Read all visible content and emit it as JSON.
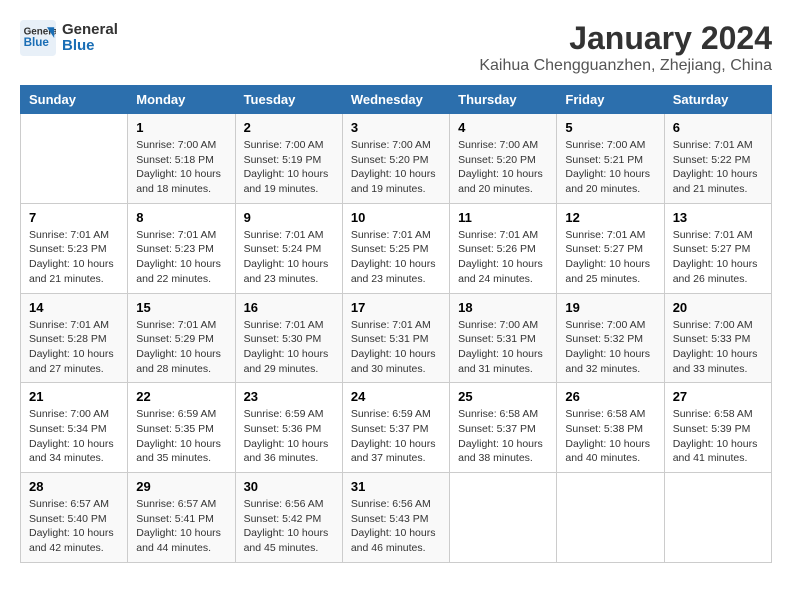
{
  "logo": {
    "text_general": "General",
    "text_blue": "Blue"
  },
  "title": "January 2024",
  "subtitle": "Kaihua Chengguanzhen, Zhejiang, China",
  "days_header": [
    "Sunday",
    "Monday",
    "Tuesday",
    "Wednesday",
    "Thursday",
    "Friday",
    "Saturday"
  ],
  "weeks": [
    [
      {
        "num": "",
        "sunrise": "",
        "sunset": "",
        "daylight": ""
      },
      {
        "num": "1",
        "sunrise": "Sunrise: 7:00 AM",
        "sunset": "Sunset: 5:18 PM",
        "daylight": "Daylight: 10 hours and 18 minutes."
      },
      {
        "num": "2",
        "sunrise": "Sunrise: 7:00 AM",
        "sunset": "Sunset: 5:19 PM",
        "daylight": "Daylight: 10 hours and 19 minutes."
      },
      {
        "num": "3",
        "sunrise": "Sunrise: 7:00 AM",
        "sunset": "Sunset: 5:20 PM",
        "daylight": "Daylight: 10 hours and 19 minutes."
      },
      {
        "num": "4",
        "sunrise": "Sunrise: 7:00 AM",
        "sunset": "Sunset: 5:20 PM",
        "daylight": "Daylight: 10 hours and 20 minutes."
      },
      {
        "num": "5",
        "sunrise": "Sunrise: 7:00 AM",
        "sunset": "Sunset: 5:21 PM",
        "daylight": "Daylight: 10 hours and 20 minutes."
      },
      {
        "num": "6",
        "sunrise": "Sunrise: 7:01 AM",
        "sunset": "Sunset: 5:22 PM",
        "daylight": "Daylight: 10 hours and 21 minutes."
      }
    ],
    [
      {
        "num": "7",
        "sunrise": "Sunrise: 7:01 AM",
        "sunset": "Sunset: 5:23 PM",
        "daylight": "Daylight: 10 hours and 21 minutes."
      },
      {
        "num": "8",
        "sunrise": "Sunrise: 7:01 AM",
        "sunset": "Sunset: 5:23 PM",
        "daylight": "Daylight: 10 hours and 22 minutes."
      },
      {
        "num": "9",
        "sunrise": "Sunrise: 7:01 AM",
        "sunset": "Sunset: 5:24 PM",
        "daylight": "Daylight: 10 hours and 23 minutes."
      },
      {
        "num": "10",
        "sunrise": "Sunrise: 7:01 AM",
        "sunset": "Sunset: 5:25 PM",
        "daylight": "Daylight: 10 hours and 23 minutes."
      },
      {
        "num": "11",
        "sunrise": "Sunrise: 7:01 AM",
        "sunset": "Sunset: 5:26 PM",
        "daylight": "Daylight: 10 hours and 24 minutes."
      },
      {
        "num": "12",
        "sunrise": "Sunrise: 7:01 AM",
        "sunset": "Sunset: 5:27 PM",
        "daylight": "Daylight: 10 hours and 25 minutes."
      },
      {
        "num": "13",
        "sunrise": "Sunrise: 7:01 AM",
        "sunset": "Sunset: 5:27 PM",
        "daylight": "Daylight: 10 hours and 26 minutes."
      }
    ],
    [
      {
        "num": "14",
        "sunrise": "Sunrise: 7:01 AM",
        "sunset": "Sunset: 5:28 PM",
        "daylight": "Daylight: 10 hours and 27 minutes."
      },
      {
        "num": "15",
        "sunrise": "Sunrise: 7:01 AM",
        "sunset": "Sunset: 5:29 PM",
        "daylight": "Daylight: 10 hours and 28 minutes."
      },
      {
        "num": "16",
        "sunrise": "Sunrise: 7:01 AM",
        "sunset": "Sunset: 5:30 PM",
        "daylight": "Daylight: 10 hours and 29 minutes."
      },
      {
        "num": "17",
        "sunrise": "Sunrise: 7:01 AM",
        "sunset": "Sunset: 5:31 PM",
        "daylight": "Daylight: 10 hours and 30 minutes."
      },
      {
        "num": "18",
        "sunrise": "Sunrise: 7:00 AM",
        "sunset": "Sunset: 5:31 PM",
        "daylight": "Daylight: 10 hours and 31 minutes."
      },
      {
        "num": "19",
        "sunrise": "Sunrise: 7:00 AM",
        "sunset": "Sunset: 5:32 PM",
        "daylight": "Daylight: 10 hours and 32 minutes."
      },
      {
        "num": "20",
        "sunrise": "Sunrise: 7:00 AM",
        "sunset": "Sunset: 5:33 PM",
        "daylight": "Daylight: 10 hours and 33 minutes."
      }
    ],
    [
      {
        "num": "21",
        "sunrise": "Sunrise: 7:00 AM",
        "sunset": "Sunset: 5:34 PM",
        "daylight": "Daylight: 10 hours and 34 minutes."
      },
      {
        "num": "22",
        "sunrise": "Sunrise: 6:59 AM",
        "sunset": "Sunset: 5:35 PM",
        "daylight": "Daylight: 10 hours and 35 minutes."
      },
      {
        "num": "23",
        "sunrise": "Sunrise: 6:59 AM",
        "sunset": "Sunset: 5:36 PM",
        "daylight": "Daylight: 10 hours and 36 minutes."
      },
      {
        "num": "24",
        "sunrise": "Sunrise: 6:59 AM",
        "sunset": "Sunset: 5:37 PM",
        "daylight": "Daylight: 10 hours and 37 minutes."
      },
      {
        "num": "25",
        "sunrise": "Sunrise: 6:58 AM",
        "sunset": "Sunset: 5:37 PM",
        "daylight": "Daylight: 10 hours and 38 minutes."
      },
      {
        "num": "26",
        "sunrise": "Sunrise: 6:58 AM",
        "sunset": "Sunset: 5:38 PM",
        "daylight": "Daylight: 10 hours and 40 minutes."
      },
      {
        "num": "27",
        "sunrise": "Sunrise: 6:58 AM",
        "sunset": "Sunset: 5:39 PM",
        "daylight": "Daylight: 10 hours and 41 minutes."
      }
    ],
    [
      {
        "num": "28",
        "sunrise": "Sunrise: 6:57 AM",
        "sunset": "Sunset: 5:40 PM",
        "daylight": "Daylight: 10 hours and 42 minutes."
      },
      {
        "num": "29",
        "sunrise": "Sunrise: 6:57 AM",
        "sunset": "Sunset: 5:41 PM",
        "daylight": "Daylight: 10 hours and 44 minutes."
      },
      {
        "num": "30",
        "sunrise": "Sunrise: 6:56 AM",
        "sunset": "Sunset: 5:42 PM",
        "daylight": "Daylight: 10 hours and 45 minutes."
      },
      {
        "num": "31",
        "sunrise": "Sunrise: 6:56 AM",
        "sunset": "Sunset: 5:43 PM",
        "daylight": "Daylight: 10 hours and 46 minutes."
      },
      {
        "num": "",
        "sunrise": "",
        "sunset": "",
        "daylight": ""
      },
      {
        "num": "",
        "sunrise": "",
        "sunset": "",
        "daylight": ""
      },
      {
        "num": "",
        "sunrise": "",
        "sunset": "",
        "daylight": ""
      }
    ]
  ]
}
